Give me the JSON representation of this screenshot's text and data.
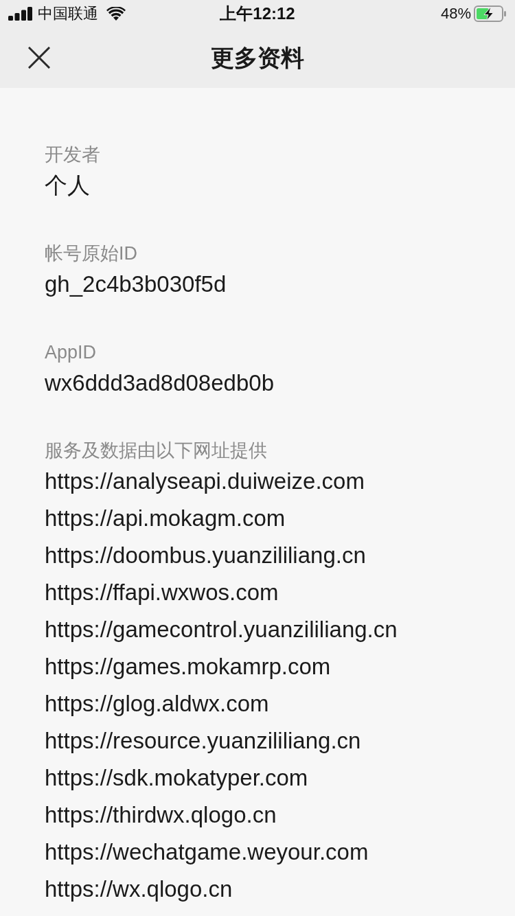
{
  "status_bar": {
    "carrier": "中国联通",
    "time": "上午12:12",
    "battery": "48%"
  },
  "nav_bar": {
    "title": "更多资料"
  },
  "fields": [
    {
      "label": "开发者",
      "value": "个人"
    },
    {
      "label": "帐号原始ID",
      "value": "gh_2c4b3b030f5d"
    },
    {
      "label": "AppID",
      "value": "wx6ddd3ad8d08edb0b"
    }
  ],
  "domains": {
    "label": "服务及数据由以下网址提供",
    "urls": [
      "https://analyseapi.duiweize.com",
      "https://api.mokagm.com",
      "https://doombus.yuanzililiang.cn",
      "https://ffapi.wxwos.com",
      "https://gamecontrol.yuanzililiang.cn",
      "https://games.mokamrp.com",
      "https://glog.aldwx.com",
      "https://resource.yuanzililiang.cn",
      "https://sdk.mokatyper.com",
      "https://thirdwx.qlogo.cn",
      "https://wechatgame.weyour.com",
      "https://wx.qlogo.cn"
    ]
  }
}
